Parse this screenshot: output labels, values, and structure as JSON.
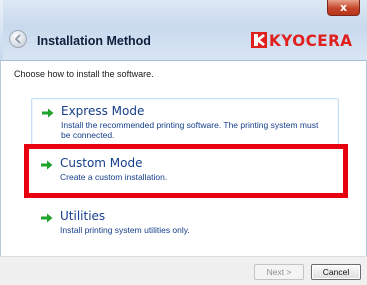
{
  "window": {
    "title": "Installation Method",
    "close_label": "x",
    "brand": "KYOCERA"
  },
  "content": {
    "instruction": "Choose how to install the software.",
    "options": [
      {
        "title": "Express Mode",
        "description_line1": "Install the recommended printing software. The printing system must",
        "description_line2": "be connected.",
        "icon": "green-arrow-icon"
      },
      {
        "title": "Custom Mode",
        "description_line1": "Create a custom installation.",
        "icon": "green-arrow-icon",
        "highlighted": true
      },
      {
        "title": "Utilities",
        "description_line1": "Install printing system utilities only.",
        "icon": "green-arrow-icon"
      }
    ]
  },
  "footer": {
    "next_label": "Next >",
    "cancel_label": "Cancel"
  },
  "colors": {
    "link_blue": "#153f8a",
    "arrow_green": "#1fa32a",
    "highlight_red": "#e8000e",
    "brand_red": "#e0201c"
  }
}
